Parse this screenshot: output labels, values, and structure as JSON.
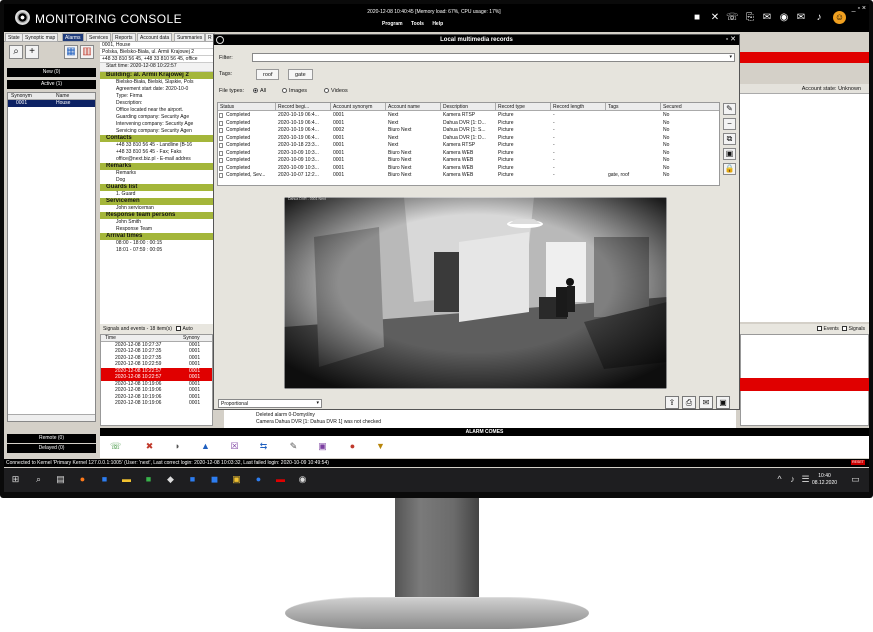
{
  "app": {
    "title": "MONITORING CONSOLE",
    "stats": "2020-12-08 10:40:45 [Memory load: 67%, CPU usage: 17%]",
    "menu": [
      "Program",
      "Tools",
      "Help"
    ]
  },
  "tabs": [
    "State",
    "Synoptic map",
    "Alarms",
    "Services",
    "Reports",
    "Account data",
    "Summaries",
    "R"
  ],
  "left": {
    "new_label": "New (0)",
    "active_label": "Active (1)",
    "columns": [
      "Synonym",
      "Name"
    ],
    "rows": [
      {
        "synonym": "0001",
        "name": "House"
      }
    ],
    "remote_label": "Remote (0)",
    "delayed_label": "Delayed (0)"
  },
  "info": {
    "header_lines": [
      "0001, House",
      "Polska, Bielsko-Biała, ul. Armii Krajowej 2",
      "+48 33 810 56 45, +48 33 810 56 45, office"
    ],
    "start_time": "Start time: 2020-12-08 10:22:57",
    "building_title": "Building: al. Armii Krajowej 2",
    "building_lines": [
      "Bielsko-Biała, Bielski, Śląskie, Pols",
      "Agreement start date:  2020-10-0",
      "Type: Firma",
      "Description:",
      "Office located near the airport.",
      "Guarding company: Security Age",
      "Intervening company: Security Age",
      "Servicing company: Security Agen"
    ],
    "contacts_title": "Contacts",
    "contacts_lines": [
      "+48 33 810 56 45 - Landline (B-16",
      "+48 33 810 56 45 - Fax; Faks",
      "office@next.biz.pl - E-mail addres"
    ],
    "remarks_title": "Remarks",
    "remarks_lines": [
      "Remarks",
      "Dog"
    ],
    "guards_title": "Guards list",
    "guards_lines": [
      "1. Guard"
    ],
    "servicemen_title": "Servicemen",
    "servicemen_lines": [
      "John serviceman"
    ],
    "response_title": "Response team persons",
    "response_lines": [
      "John Smith",
      "Response Team"
    ],
    "arrival_title": "Arrival times",
    "arrival_lines": [
      "08:00 - 18:00 : 00:15",
      "18:01 - 07:59 : 00:05"
    ]
  },
  "signals": {
    "label": "Signals and events - 18 item(s)",
    "auto_label": "Auto",
    "col_time": "Time",
    "col_synonym": "Synony",
    "rows": [
      {
        "time": "2020-12-08 10:27:37",
        "syn": "0001",
        "red": false
      },
      {
        "time": "2020-12-08 10:27:35",
        "syn": "0001",
        "red": false
      },
      {
        "time": "2020-12-08 10:27:35",
        "syn": "0001",
        "red": false
      },
      {
        "time": "2020-12-08 10:22:59",
        "syn": "0001",
        "red": false
      },
      {
        "time": "2020-12-08 10:22:57",
        "syn": "0001",
        "red": true
      },
      {
        "time": "2020-12-08 10:22:57",
        "syn": "0001",
        "red": true
      },
      {
        "time": "2020-12-08 10:19:06",
        "syn": "0001",
        "red": false
      },
      {
        "time": "2020-12-08 10:19:06",
        "syn": "0001",
        "red": false
      },
      {
        "time": "2020-12-08 10:19:06",
        "syn": "0001",
        "red": false
      },
      {
        "time": "2020-12-08 10:19:06",
        "syn": "0001",
        "red": false
      }
    ],
    "messages": [
      "Deleted alarm 0-Domyślny",
      "Camera Dahua DVR [1: Dahua DVR 1] was not checked"
    ]
  },
  "right": {
    "account_state": "Account state: Unknown",
    "events_label": "Events",
    "signals_label": "Signals"
  },
  "alarm_comes": "ALARM COMES",
  "alarm_icon_colors": [
    "#2a8a2a",
    "#c0392b",
    "#555555",
    "#1f5fbf",
    "#7b3fa0",
    "#1f5fbf",
    "#555555",
    "#7b3fa0",
    "#c0392b",
    "#b8860b"
  ],
  "status_bar": "Connected to Kernel 'Primary Kernel 127.0.0.1:1005' (User: 'next', Last correct login: 2020-12-08 10:03:32, Last failed login: 2020-10-09 10:49:54)",
  "status_badge": "RESET",
  "taskbar": {
    "time": "10:40",
    "date": "08.12.2020"
  },
  "dialog": {
    "title": "Local multimedia records",
    "filter_label": "Filter:",
    "tags_label": "Tags:",
    "tags": [
      "roof",
      "gate"
    ],
    "filetypes_label": "File types:",
    "filetypes": [
      "All",
      "Images",
      "Videos"
    ],
    "filetype_selected": "All",
    "columns": [
      "Status",
      "Record begi...",
      "Account synonym",
      "Account name",
      "Description",
      "Record type",
      "Record length",
      "Tags",
      "Secured"
    ],
    "rows": [
      [
        "Completed",
        "2020-10-19 06:4...",
        "0001",
        "Next",
        "Kamera RTSP",
        "Picture",
        "-",
        "",
        "No"
      ],
      [
        "Completed",
        "2020-10-19 06:4...",
        "0001",
        "Next",
        "Dahua DVR [1: D...",
        "Picture",
        "-",
        "",
        "No"
      ],
      [
        "Completed",
        "2020-10-19 06:4...",
        "0002",
        "Biuro Next",
        "Dahua DVR [1: S...",
        "Picture",
        "-",
        "",
        "No"
      ],
      [
        "Completed",
        "2020-10-19 06:4...",
        "0001",
        "Next",
        "Dahua DVR [1: D...",
        "Picture",
        "-",
        "",
        "No"
      ],
      [
        "Completed",
        "2020-10-18 23:3...",
        "0001",
        "Next",
        "Kamera RTSP",
        "Picture",
        "-",
        "",
        "No"
      ],
      [
        "Completed",
        "2020-10-09 10:3...",
        "0001",
        "Biuro Next",
        "Kamera WEB",
        "Picture",
        "-",
        "",
        "No"
      ],
      [
        "Completed",
        "2020-10-09 10:3...",
        "0001",
        "Biuro Next",
        "Kamera WEB",
        "Picture",
        "-",
        "",
        "No"
      ],
      [
        "Completed",
        "2020-10-09 10:3...",
        "0001",
        "Biuro Next",
        "Kamera WEB",
        "Picture",
        "-",
        "",
        "No"
      ],
      [
        "Completed, Sev...",
        "2020-10-07 12:2...",
        "0001",
        "Biuro Next",
        "Kamera WEB",
        "Picture",
        "-",
        "gate, roof",
        "No"
      ]
    ],
    "video_caption": "Dahua DVR - 0001 Next",
    "view_mode": "Proportional"
  }
}
